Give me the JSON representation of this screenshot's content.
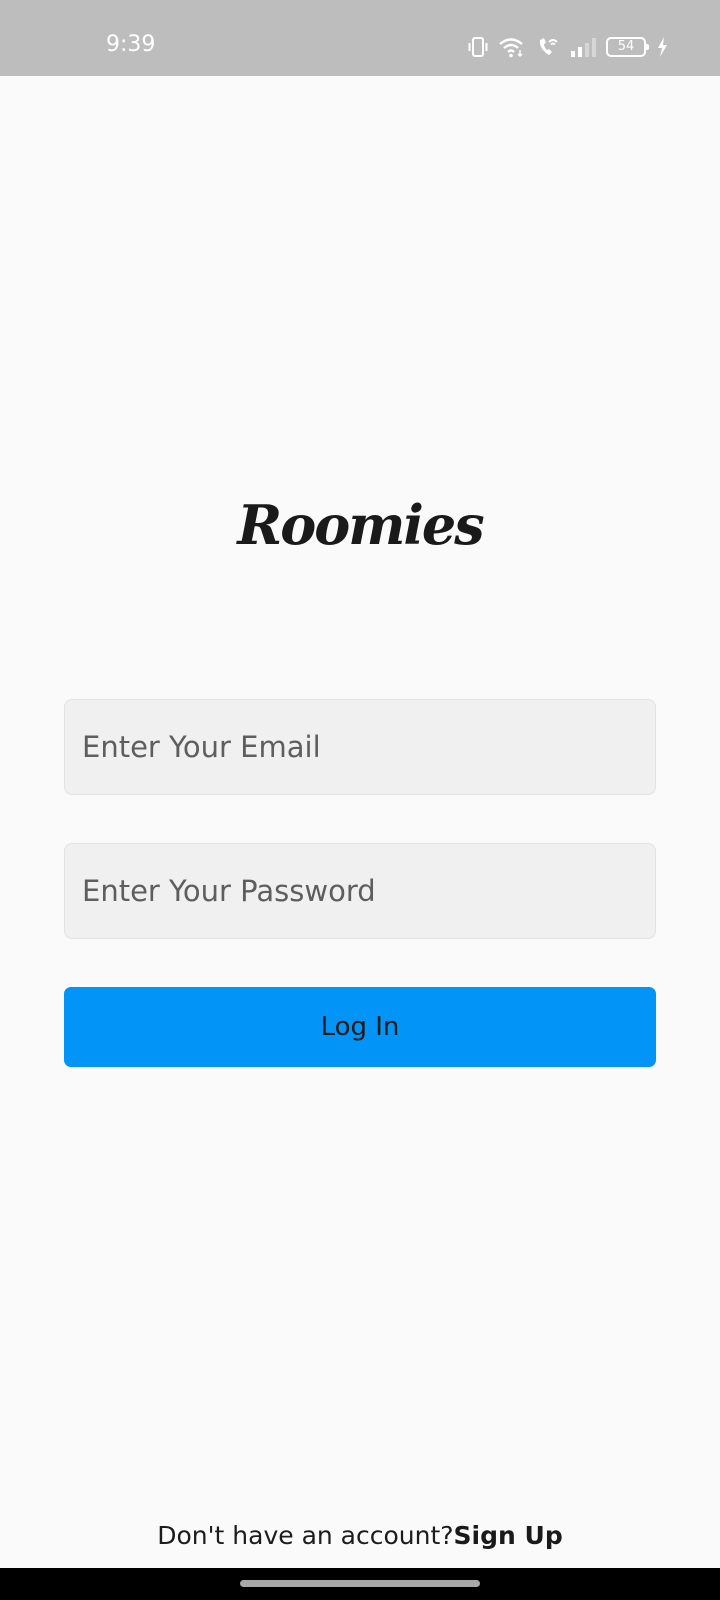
{
  "status_bar": {
    "time": "9:39",
    "battery_level": "54",
    "icons": [
      "vibrate-icon",
      "wifi-icon",
      "wifi-call-icon",
      "signal-icon",
      "battery-icon",
      "charging-icon"
    ]
  },
  "app": {
    "logo_text": "Roomies"
  },
  "login_form": {
    "email_placeholder": "Enter Your Email",
    "email_value": "",
    "password_placeholder": "Enter Your Password",
    "password_value": "",
    "login_label": "Log In"
  },
  "signup": {
    "prompt": "Don't have an account?",
    "link_label": "Sign Up"
  },
  "colors": {
    "primary_button": "#0295f7",
    "background": "#fafafa",
    "status_bar": "#bdbdbd",
    "input_background": "#f0f0f0"
  }
}
